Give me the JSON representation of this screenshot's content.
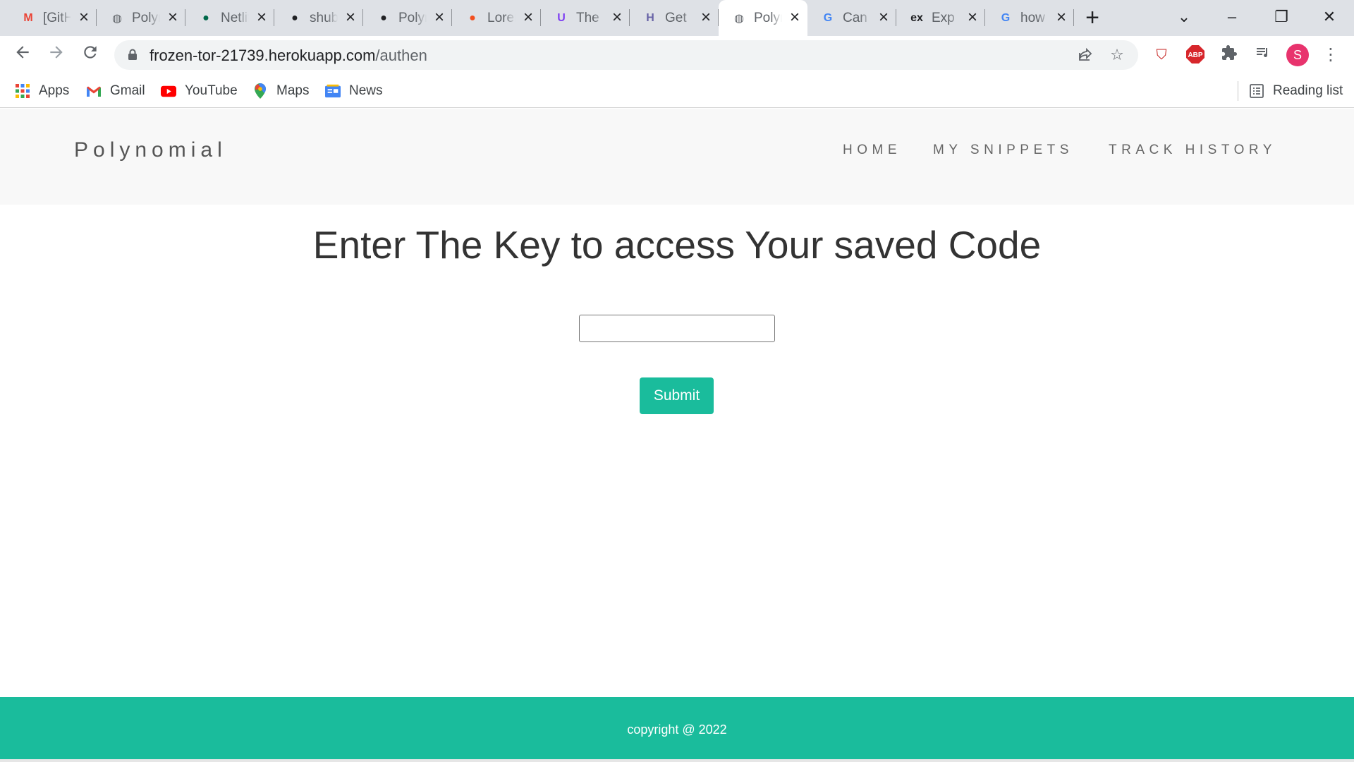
{
  "browser": {
    "tabs": [
      {
        "title": "[GitHub]",
        "icon": "gmail-icon",
        "favicon_text": "M",
        "color": "#ea4335"
      },
      {
        "title": "Polynomial",
        "icon": "globe-icon",
        "favicon_text": "◍",
        "color": "#5f6368"
      },
      {
        "title": "Netlify",
        "icon": "mongodb-leaf-icon",
        "favicon_text": "●",
        "color": "#00684a"
      },
      {
        "title": "shubh",
        "icon": "github-icon",
        "favicon_text": "●",
        "color": "#202124"
      },
      {
        "title": "Polynomial",
        "icon": "github-icon",
        "favicon_text": "●",
        "color": "#202124"
      },
      {
        "title": "Lorem",
        "icon": "figma-icon",
        "favicon_text": "●",
        "color": "#f24e1e"
      },
      {
        "title": "The",
        "icon": "u-logo-icon",
        "favicon_text": "U",
        "color": "#7e3ff2"
      },
      {
        "title": "Get",
        "icon": "heroku-icon",
        "favicon_text": "H",
        "color": "#6762a6"
      },
      {
        "title": "Polynomial",
        "icon": "globe-icon",
        "favicon_text": "◍",
        "color": "#5f6368",
        "active": true
      },
      {
        "title": "Can",
        "icon": "google-icon",
        "favicon_text": "G",
        "color": "#4285f4"
      },
      {
        "title": "Exp",
        "icon": "ex-icon",
        "favicon_text": "ex",
        "color": "#202124"
      },
      {
        "title": "how",
        "icon": "google-icon",
        "favicon_text": "G",
        "color": "#4285f4"
      }
    ],
    "url_host": "frozen-tor-21739.herokuapp.com",
    "url_path": "/authen",
    "profile_initial": "S",
    "abp_label": "ABP",
    "bookmarks": [
      {
        "label": "Apps",
        "icon": "apps-grid-icon"
      },
      {
        "label": "Gmail",
        "icon": "gmail-icon"
      },
      {
        "label": "YouTube",
        "icon": "youtube-icon"
      },
      {
        "label": "Maps",
        "icon": "maps-pin-icon"
      },
      {
        "label": "News",
        "icon": "news-icon"
      }
    ],
    "reading_list": "Reading list"
  },
  "site": {
    "brand": "Polynomial",
    "nav": {
      "home": "HOME",
      "snippets": "MY SNIPPETS",
      "history": "TRACK HISTORY"
    },
    "heading": "Enter The Key to access Your saved Code",
    "key_input_value": "",
    "submit_label": "Submit",
    "footer": "copyright @ 2022",
    "accent_color": "#1abc9c"
  }
}
